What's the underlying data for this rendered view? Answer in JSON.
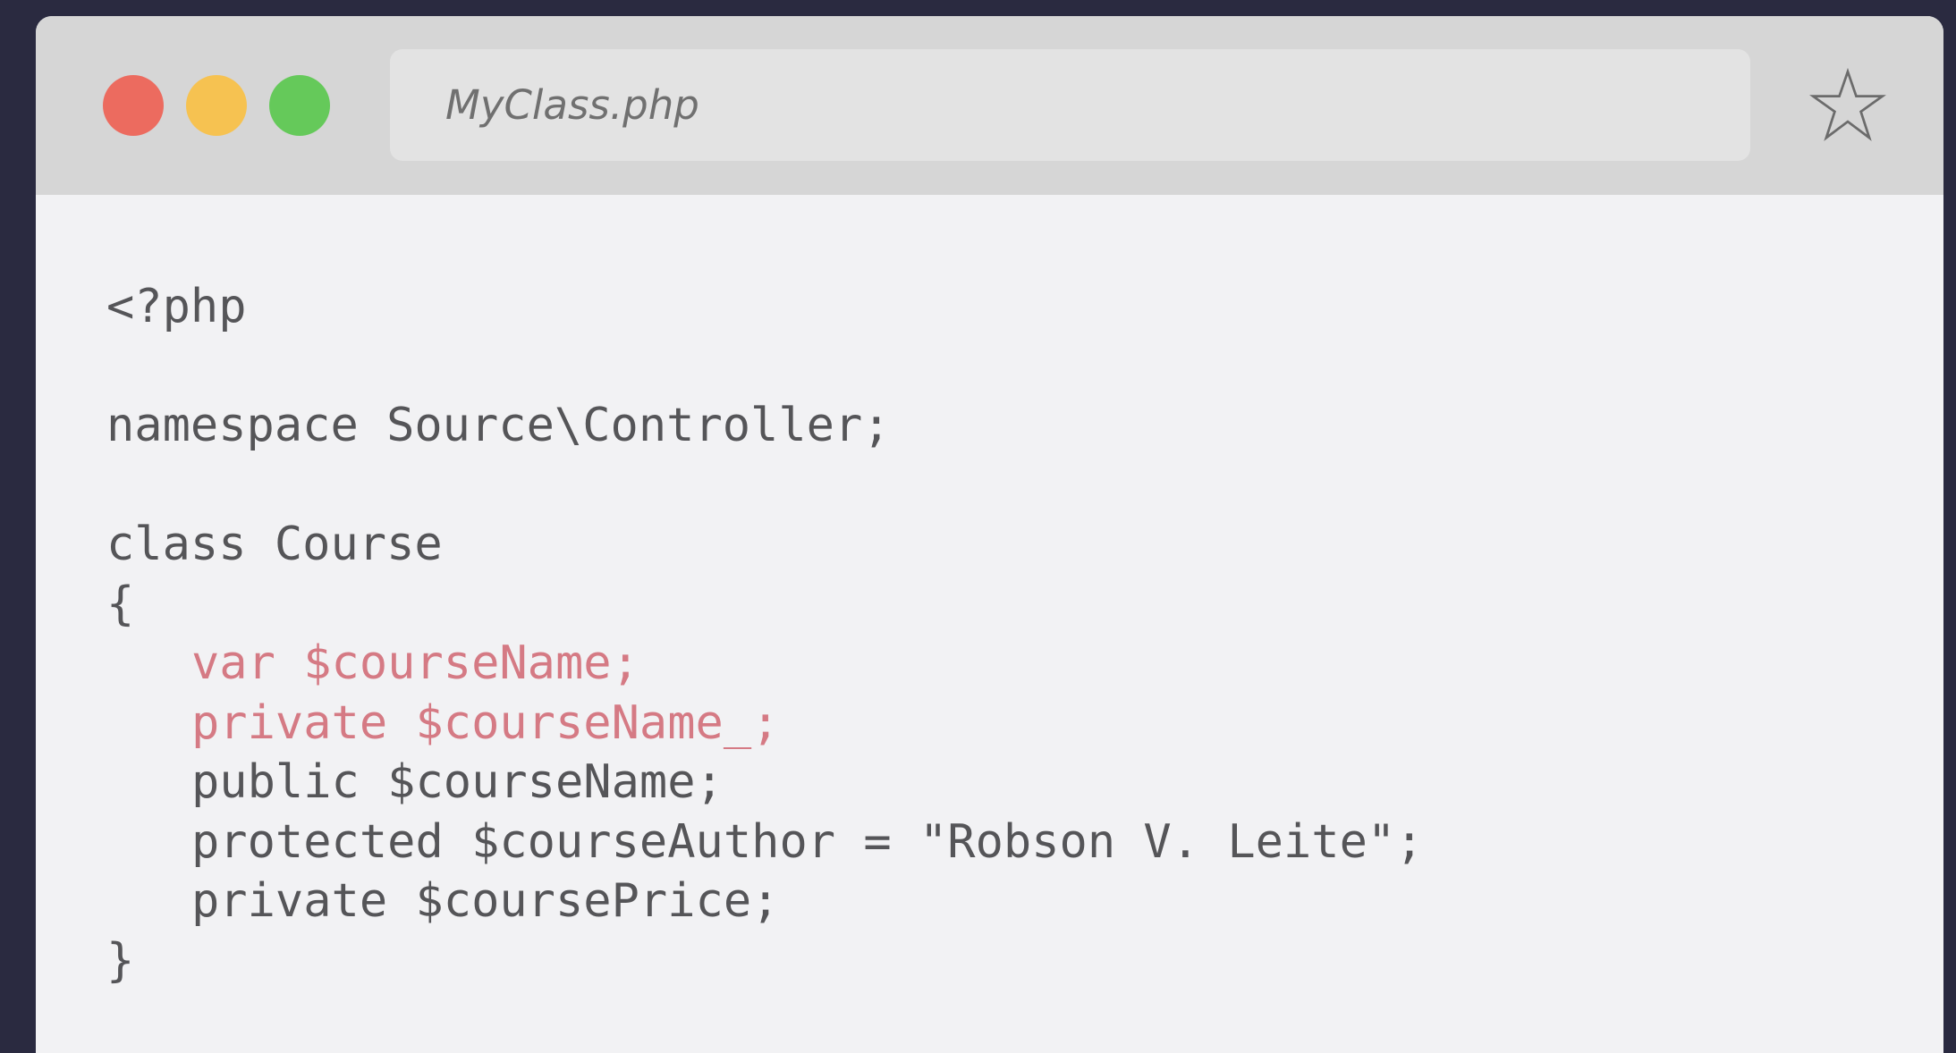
{
  "window": {
    "file_title": "MyClass.php",
    "controls": [
      {
        "name": "close",
        "color": "#ec6b5f"
      },
      {
        "name": "minimize",
        "color": "#f6c251"
      },
      {
        "name": "maximize",
        "color": "#65c95a"
      }
    ],
    "star_icon": "star-outline-icon"
  },
  "code": {
    "lines": [
      "<?php",
      "",
      "namespace Source\\Controller;",
      "",
      "class Course",
      "{",
      "var $courseName;",
      "private $courseName_;",
      "public $courseName;",
      "protected $courseAuthor = \"Robson V. Leite\";",
      "private $coursePrice;",
      "}"
    ],
    "highlight_color": "#d57a84",
    "text_color": "#555558"
  }
}
